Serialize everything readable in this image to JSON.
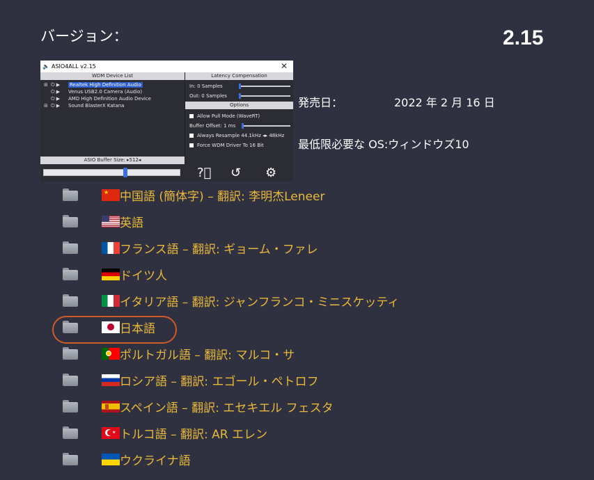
{
  "version": {
    "label": "バージョン：",
    "number": "2.15"
  },
  "app": {
    "title": "ASIO4ALL v2.15",
    "close": "✕",
    "wdm_header": "WDM Device List",
    "devices": [
      {
        "name": "Realtek High Definition Audio",
        "selected": true
      },
      {
        "name": "Venus USB2.0 Camera (Audio)",
        "selected": false
      },
      {
        "name": "AMD High Definition Audio Device",
        "selected": false
      },
      {
        "name": "Sound BlasterX Katana",
        "selected": false
      }
    ],
    "latency_header": "Latency Compensation",
    "latency_in": "In: 0 Samples",
    "latency_out": "Out: 0 Samples",
    "options_header": "Options",
    "options": [
      "Allow Pull Mode (WaveRT)",
      "Buffer Offset: 1 ms",
      "Always Resample 44.1kHz ◂▸ 48kHz",
      "Force WDM Driver To 16 Bit"
    ],
    "buffer_size": "ASIO Buffer Size: ▸512◂"
  },
  "release": {
    "label": "発売日：",
    "date": "2022 年 2 月 16 日"
  },
  "os": {
    "text": "最低限必要な OS:ウィンドウズ10"
  },
  "languages": [
    {
      "flag": "cn",
      "text": "中国語 (簡体字) – 翻訳: 李明杰Leneer"
    },
    {
      "flag": "us",
      "text": "英語"
    },
    {
      "flag": "fr",
      "text": "フランス語 – 翻訳: ギョーム・ファレ"
    },
    {
      "flag": "de",
      "text": "ドイツ人"
    },
    {
      "flag": "it",
      "text": "イタリア語 – 翻訳: ジャンフランコ・ミニスケッティ"
    },
    {
      "flag": "jp",
      "text": "日本語"
    },
    {
      "flag": "pt",
      "text": "ポルトガル語 – 翻訳: マルコ・サ"
    },
    {
      "flag": "ru",
      "text": "ロシア語 – 翻訳: エゴール・ペトロフ"
    },
    {
      "flag": "es",
      "text": "スペイン語 – 翻訳: エセキエル フェスタ"
    },
    {
      "flag": "tr",
      "text": "トルコ語 – 翻訳: AR エレン"
    },
    {
      "flag": "ua",
      "text": "ウクライナ語"
    }
  ],
  "colors": {
    "background": "#2f3040",
    "link": "#e8b93a",
    "highlight": "#d05b28"
  }
}
